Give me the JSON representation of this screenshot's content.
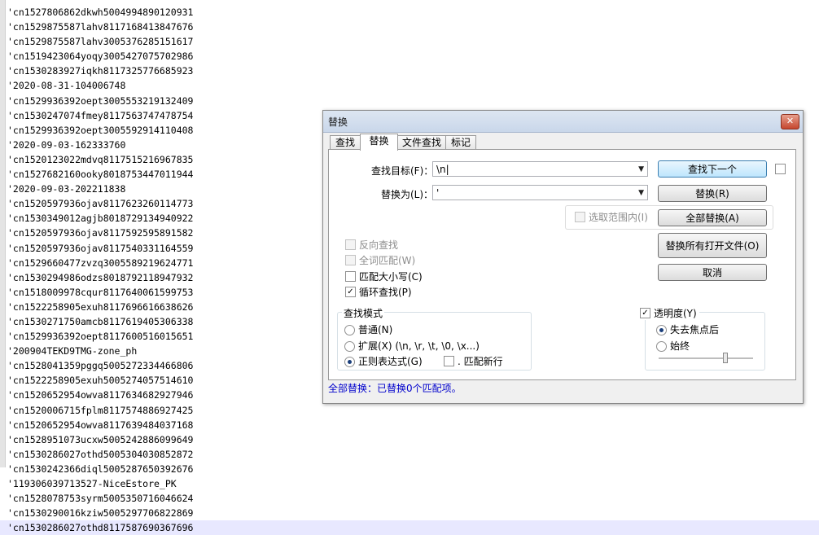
{
  "editor": {
    "lines": [
      "'cn1527806862dkwh5004994890120931",
      "'cn1529875587lahv8117168413847676",
      "'cn1529875587lahv3005376285151617",
      "'cn1519423064yoqy3005427075702986",
      "'cn1530283927iqkh8117325776685923",
      "'2020-08-31-104006748",
      "'cn1529936392oept3005553219132409",
      "'cn1530247074fmey8117563747478754",
      "'cn1529936392oept3005592914110408",
      "'2020-09-03-162333760",
      "'cn1520123022mdvq8117515216967835",
      "'cn1527682160ooky8018753447011944",
      "'2020-09-03-202211838",
      "'cn1520597936ojav8117623260114773",
      "'cn1530349012agjb8018729134940922",
      "'cn1520597936ojav8117592595891582",
      "'cn1520597936ojav8117540331164559",
      "'cn1529660477zvzq3005589219624771",
      "'cn1530294986odzs8018792118947932",
      "'cn1518009978cqur8117640061599753",
      "'cn1522258905exuh8117696616638626",
      "'cn1530271750amcb8117619405306338",
      "'cn1529936392oept8117600516015651",
      "'200904TEKD9TMG-zone_ph",
      "'cn1528041359pggq5005272334466806",
      "'cn1522258905exuh5005274057514610",
      "'cn1520652954owva8117634682927946",
      "'cn1520006715fplm8117574886927425",
      "'cn1520652954owva8117639484037168",
      "'cn1528951073ucxw5005242886099649",
      "'cn1530286027othd5005304030852872",
      "'cn1530242366diql5005287650392676",
      "'119306039713527-NiceEstore_PK",
      "'cn1528078753syrm5005350716046624",
      "'cn1530290016kziw5005297706822869",
      "'cn1530286027othd8117587690367696"
    ]
  },
  "dialog": {
    "title": "替换",
    "close_glyph": "✕",
    "tabs": [
      "查找",
      "替换",
      "文件查找",
      "标记"
    ],
    "find_label": "查找目标(F)：",
    "find_value": "\\n|",
    "replace_label": "替换为(L)：",
    "replace_value": "'",
    "in_selection_label": "选取范围内(I)",
    "buttons": {
      "find_next": "查找下一个",
      "replace": "替换(R)",
      "replace_all": "全部替换(A)",
      "replace_all_open": "替换所有打开文件(O)",
      "cancel": "取消"
    },
    "options": {
      "backward": "反向查找",
      "whole_word": "全词匹配(W)",
      "match_case": "匹配大小写(C)",
      "wrap": "循环查找(P)",
      "wrap_check": "✓"
    },
    "search_mode": {
      "title": "查找模式",
      "normal": "普通(N)",
      "extended": "扩展(X) (\\n, \\r, \\t, \\0, \\x...)",
      "regex": "正则表达式(G)",
      "dot_newline": ". 匹配新行"
    },
    "transparency": {
      "title": "透明度(Y)",
      "check": "✓",
      "on_lose_focus": "失去焦点后",
      "always": "始终",
      "level_fraction": 0.72
    },
    "status": "全部替换：已替换0个匹配项。"
  }
}
